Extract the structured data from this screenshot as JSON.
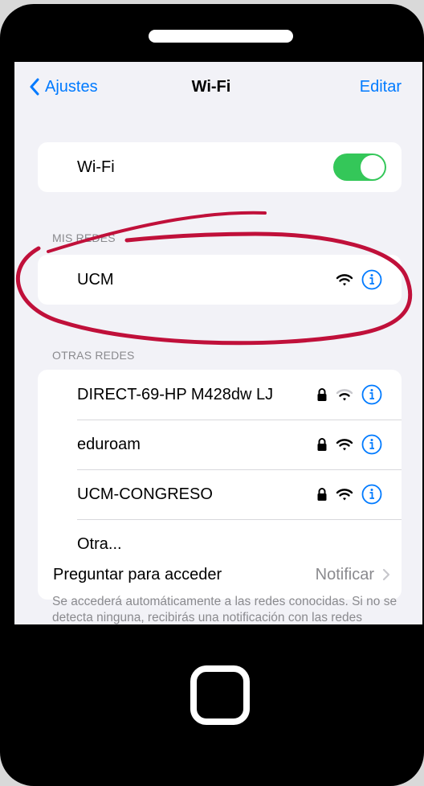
{
  "nav": {
    "back_label": "Ajustes",
    "title": "Wi-Fi",
    "edit_label": "Editar"
  },
  "wifi_toggle": {
    "label": "Wi-Fi",
    "on": true
  },
  "my_networks": {
    "header": "MIS REDES",
    "items": [
      {
        "name": "UCM",
        "locked": false
      }
    ]
  },
  "other_networks": {
    "header": "OTRAS REDES",
    "items": [
      {
        "name": "DIRECT-69-HP M428dw LJ",
        "locked": true
      },
      {
        "name": "eduroam",
        "locked": true
      },
      {
        "name": "UCM-CONGRESO",
        "locked": true
      },
      {
        "name": "Otra..."
      }
    ]
  },
  "ask_to_join": {
    "label": "Preguntar para acceder",
    "value": "Notificar"
  },
  "footer": "Se accederá automáticamente a las redes conocidas. Si no se detecta ninguna, recibirás una notificación con las redes disponibles.",
  "colors": {
    "accent": "#007aff",
    "toggle_on": "#34c759",
    "highlight": "#c0103a",
    "background": "#f2f2f7"
  },
  "icons": [
    "chevron-left-icon",
    "wifi-icon",
    "lock-icon",
    "info-icon",
    "chevron-right-icon"
  ]
}
